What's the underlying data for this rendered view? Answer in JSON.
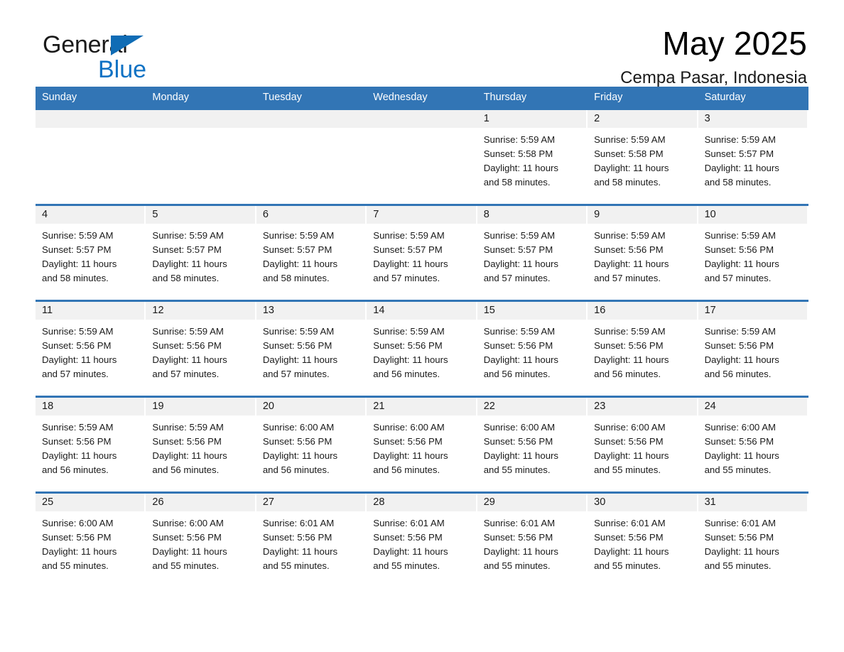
{
  "logo": {
    "word_one": "General",
    "word_two": "Blue",
    "triangle_color": "#0f6cb5",
    "blue_color": "#0f72c4"
  },
  "header": {
    "title": "May 2025",
    "subtitle": "Cempa Pasar, Indonesia"
  },
  "theme": {
    "header_bar": "#3275b5",
    "day_band": "#f1f1f1",
    "text": "#1a1a1a"
  },
  "weekdays": [
    "Sunday",
    "Monday",
    "Tuesday",
    "Wednesday",
    "Thursday",
    "Friday",
    "Saturday"
  ],
  "weeks": [
    [
      {
        "day": "",
        "sunrise": "",
        "sunset": "",
        "daylight_line1": "",
        "daylight_line2": ""
      },
      {
        "day": "",
        "sunrise": "",
        "sunset": "",
        "daylight_line1": "",
        "daylight_line2": ""
      },
      {
        "day": "",
        "sunrise": "",
        "sunset": "",
        "daylight_line1": "",
        "daylight_line2": ""
      },
      {
        "day": "",
        "sunrise": "",
        "sunset": "",
        "daylight_line1": "",
        "daylight_line2": ""
      },
      {
        "day": "1",
        "sunrise": "Sunrise: 5:59 AM",
        "sunset": "Sunset: 5:58 PM",
        "daylight_line1": "Daylight: 11 hours",
        "daylight_line2": "and 58 minutes."
      },
      {
        "day": "2",
        "sunrise": "Sunrise: 5:59 AM",
        "sunset": "Sunset: 5:58 PM",
        "daylight_line1": "Daylight: 11 hours",
        "daylight_line2": "and 58 minutes."
      },
      {
        "day": "3",
        "sunrise": "Sunrise: 5:59 AM",
        "sunset": "Sunset: 5:57 PM",
        "daylight_line1": "Daylight: 11 hours",
        "daylight_line2": "and 58 minutes."
      }
    ],
    [
      {
        "day": "4",
        "sunrise": "Sunrise: 5:59 AM",
        "sunset": "Sunset: 5:57 PM",
        "daylight_line1": "Daylight: 11 hours",
        "daylight_line2": "and 58 minutes."
      },
      {
        "day": "5",
        "sunrise": "Sunrise: 5:59 AM",
        "sunset": "Sunset: 5:57 PM",
        "daylight_line1": "Daylight: 11 hours",
        "daylight_line2": "and 58 minutes."
      },
      {
        "day": "6",
        "sunrise": "Sunrise: 5:59 AM",
        "sunset": "Sunset: 5:57 PM",
        "daylight_line1": "Daylight: 11 hours",
        "daylight_line2": "and 58 minutes."
      },
      {
        "day": "7",
        "sunrise": "Sunrise: 5:59 AM",
        "sunset": "Sunset: 5:57 PM",
        "daylight_line1": "Daylight: 11 hours",
        "daylight_line2": "and 57 minutes."
      },
      {
        "day": "8",
        "sunrise": "Sunrise: 5:59 AM",
        "sunset": "Sunset: 5:57 PM",
        "daylight_line1": "Daylight: 11 hours",
        "daylight_line2": "and 57 minutes."
      },
      {
        "day": "9",
        "sunrise": "Sunrise: 5:59 AM",
        "sunset": "Sunset: 5:56 PM",
        "daylight_line1": "Daylight: 11 hours",
        "daylight_line2": "and 57 minutes."
      },
      {
        "day": "10",
        "sunrise": "Sunrise: 5:59 AM",
        "sunset": "Sunset: 5:56 PM",
        "daylight_line1": "Daylight: 11 hours",
        "daylight_line2": "and 57 minutes."
      }
    ],
    [
      {
        "day": "11",
        "sunrise": "Sunrise: 5:59 AM",
        "sunset": "Sunset: 5:56 PM",
        "daylight_line1": "Daylight: 11 hours",
        "daylight_line2": "and 57 minutes."
      },
      {
        "day": "12",
        "sunrise": "Sunrise: 5:59 AM",
        "sunset": "Sunset: 5:56 PM",
        "daylight_line1": "Daylight: 11 hours",
        "daylight_line2": "and 57 minutes."
      },
      {
        "day": "13",
        "sunrise": "Sunrise: 5:59 AM",
        "sunset": "Sunset: 5:56 PM",
        "daylight_line1": "Daylight: 11 hours",
        "daylight_line2": "and 57 minutes."
      },
      {
        "day": "14",
        "sunrise": "Sunrise: 5:59 AM",
        "sunset": "Sunset: 5:56 PM",
        "daylight_line1": "Daylight: 11 hours",
        "daylight_line2": "and 56 minutes."
      },
      {
        "day": "15",
        "sunrise": "Sunrise: 5:59 AM",
        "sunset": "Sunset: 5:56 PM",
        "daylight_line1": "Daylight: 11 hours",
        "daylight_line2": "and 56 minutes."
      },
      {
        "day": "16",
        "sunrise": "Sunrise: 5:59 AM",
        "sunset": "Sunset: 5:56 PM",
        "daylight_line1": "Daylight: 11 hours",
        "daylight_line2": "and 56 minutes."
      },
      {
        "day": "17",
        "sunrise": "Sunrise: 5:59 AM",
        "sunset": "Sunset: 5:56 PM",
        "daylight_line1": "Daylight: 11 hours",
        "daylight_line2": "and 56 minutes."
      }
    ],
    [
      {
        "day": "18",
        "sunrise": "Sunrise: 5:59 AM",
        "sunset": "Sunset: 5:56 PM",
        "daylight_line1": "Daylight: 11 hours",
        "daylight_line2": "and 56 minutes."
      },
      {
        "day": "19",
        "sunrise": "Sunrise: 5:59 AM",
        "sunset": "Sunset: 5:56 PM",
        "daylight_line1": "Daylight: 11 hours",
        "daylight_line2": "and 56 minutes."
      },
      {
        "day": "20",
        "sunrise": "Sunrise: 6:00 AM",
        "sunset": "Sunset: 5:56 PM",
        "daylight_line1": "Daylight: 11 hours",
        "daylight_line2": "and 56 minutes."
      },
      {
        "day": "21",
        "sunrise": "Sunrise: 6:00 AM",
        "sunset": "Sunset: 5:56 PM",
        "daylight_line1": "Daylight: 11 hours",
        "daylight_line2": "and 56 minutes."
      },
      {
        "day": "22",
        "sunrise": "Sunrise: 6:00 AM",
        "sunset": "Sunset: 5:56 PM",
        "daylight_line1": "Daylight: 11 hours",
        "daylight_line2": "and 55 minutes."
      },
      {
        "day": "23",
        "sunrise": "Sunrise: 6:00 AM",
        "sunset": "Sunset: 5:56 PM",
        "daylight_line1": "Daylight: 11 hours",
        "daylight_line2": "and 55 minutes."
      },
      {
        "day": "24",
        "sunrise": "Sunrise: 6:00 AM",
        "sunset": "Sunset: 5:56 PM",
        "daylight_line1": "Daylight: 11 hours",
        "daylight_line2": "and 55 minutes."
      }
    ],
    [
      {
        "day": "25",
        "sunrise": "Sunrise: 6:00 AM",
        "sunset": "Sunset: 5:56 PM",
        "daylight_line1": "Daylight: 11 hours",
        "daylight_line2": "and 55 minutes."
      },
      {
        "day": "26",
        "sunrise": "Sunrise: 6:00 AM",
        "sunset": "Sunset: 5:56 PM",
        "daylight_line1": "Daylight: 11 hours",
        "daylight_line2": "and 55 minutes."
      },
      {
        "day": "27",
        "sunrise": "Sunrise: 6:01 AM",
        "sunset": "Sunset: 5:56 PM",
        "daylight_line1": "Daylight: 11 hours",
        "daylight_line2": "and 55 minutes."
      },
      {
        "day": "28",
        "sunrise": "Sunrise: 6:01 AM",
        "sunset": "Sunset: 5:56 PM",
        "daylight_line1": "Daylight: 11 hours",
        "daylight_line2": "and 55 minutes."
      },
      {
        "day": "29",
        "sunrise": "Sunrise: 6:01 AM",
        "sunset": "Sunset: 5:56 PM",
        "daylight_line1": "Daylight: 11 hours",
        "daylight_line2": "and 55 minutes."
      },
      {
        "day": "30",
        "sunrise": "Sunrise: 6:01 AM",
        "sunset": "Sunset: 5:56 PM",
        "daylight_line1": "Daylight: 11 hours",
        "daylight_line2": "and 55 minutes."
      },
      {
        "day": "31",
        "sunrise": "Sunrise: 6:01 AM",
        "sunset": "Sunset: 5:56 PM",
        "daylight_line1": "Daylight: 11 hours",
        "daylight_line2": "and 55 minutes."
      }
    ]
  ]
}
